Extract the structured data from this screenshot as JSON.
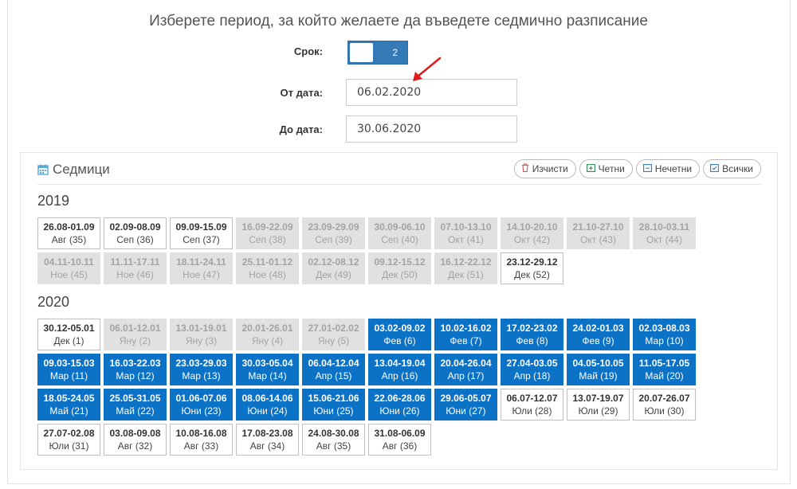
{
  "heading": "Изберете период, за който желаете да въведете седмично разписание",
  "term": {
    "label": "Срок:",
    "value": "2"
  },
  "from": {
    "label": "От дата:",
    "value": "06.02.2020"
  },
  "to": {
    "label": "До дата:",
    "value": "30.06.2020"
  },
  "colors": {
    "selected": "#0b72c6",
    "past": "#e1e1e1",
    "accent": "#337ab7",
    "arrow": "#e01b1b"
  },
  "panel": {
    "title": "Седмици",
    "buttons": {
      "clear": "Изчисти",
      "even": "Четни",
      "odd": "Нечетни",
      "all": "Всички"
    }
  },
  "years": [
    {
      "year": "2019",
      "weeks": [
        {
          "d": "26.08-01.09",
          "m": "Авг (35)",
          "s": "open"
        },
        {
          "d": "02.09-08.09",
          "m": "Сеп (36)",
          "s": "open"
        },
        {
          "d": "09.09-15.09",
          "m": "Сеп (37)",
          "s": "open"
        },
        {
          "d": "16.09-22.09",
          "m": "Сеп (38)",
          "s": "past"
        },
        {
          "d": "23.09-29.09",
          "m": "Сеп (39)",
          "s": "past"
        },
        {
          "d": "30.09-06.10",
          "m": "Сеп (40)",
          "s": "past"
        },
        {
          "d": "07.10-13.10",
          "m": "Окт (41)",
          "s": "past"
        },
        {
          "d": "14.10-20.10",
          "m": "Окт (42)",
          "s": "past"
        },
        {
          "d": "21.10-27.10",
          "m": "Окт (43)",
          "s": "past"
        },
        {
          "d": "28.10-03.11",
          "m": "Окт (44)",
          "s": "past"
        },
        {
          "d": "04.11-10.11",
          "m": "Ное (45)",
          "s": "past"
        },
        {
          "d": "11.11-17.11",
          "m": "Ное (46)",
          "s": "past"
        },
        {
          "d": "18.11-24.11",
          "m": "Ное (47)",
          "s": "past"
        },
        {
          "d": "25.11-01.12",
          "m": "Ное (48)",
          "s": "past"
        },
        {
          "d": "02.12-08.12",
          "m": "Дек (49)",
          "s": "past"
        },
        {
          "d": "09.12-15.12",
          "m": "Дек (50)",
          "s": "past"
        },
        {
          "d": "16.12-22.12",
          "m": "Дек (51)",
          "s": "past"
        },
        {
          "d": "23.12-29.12",
          "m": "Дек (52)",
          "s": "open"
        }
      ]
    },
    {
      "year": "2020",
      "weeks": [
        {
          "d": "30.12-05.01",
          "m": "Дек (1)",
          "s": "open"
        },
        {
          "d": "06.01-12.01",
          "m": "Яну (2)",
          "s": "past"
        },
        {
          "d": "13.01-19.01",
          "m": "Яну (3)",
          "s": "past"
        },
        {
          "d": "20.01-26.01",
          "m": "Яну (4)",
          "s": "past"
        },
        {
          "d": "27.01-02.02",
          "m": "Яну (5)",
          "s": "past"
        },
        {
          "d": "03.02-09.02",
          "m": "Фев (6)",
          "s": "sel"
        },
        {
          "d": "10.02-16.02",
          "m": "Фев (7)",
          "s": "sel"
        },
        {
          "d": "17.02-23.02",
          "m": "Фев (8)",
          "s": "sel"
        },
        {
          "d": "24.02-01.03",
          "m": "Фев (9)",
          "s": "sel"
        },
        {
          "d": "02.03-08.03",
          "m": "Мар (10)",
          "s": "sel"
        },
        {
          "d": "09.03-15.03",
          "m": "Мар (11)",
          "s": "sel"
        },
        {
          "d": "16.03-22.03",
          "m": "Мар (12)",
          "s": "sel"
        },
        {
          "d": "23.03-29.03",
          "m": "Мар (13)",
          "s": "sel"
        },
        {
          "d": "30.03-05.04",
          "m": "Мар (14)",
          "s": "sel"
        },
        {
          "d": "06.04-12.04",
          "m": "Апр (15)",
          "s": "sel"
        },
        {
          "d": "13.04-19.04",
          "m": "Апр (16)",
          "s": "sel"
        },
        {
          "d": "20.04-26.04",
          "m": "Апр (17)",
          "s": "sel"
        },
        {
          "d": "27.04-03.05",
          "m": "Апр (18)",
          "s": "sel"
        },
        {
          "d": "04.05-10.05",
          "m": "Май (19)",
          "s": "sel"
        },
        {
          "d": "11.05-17.05",
          "m": "Май (20)",
          "s": "sel"
        },
        {
          "d": "18.05-24.05",
          "m": "Май (21)",
          "s": "sel"
        },
        {
          "d": "25.05-31.05",
          "m": "Май (22)",
          "s": "sel"
        },
        {
          "d": "01.06-07.06",
          "m": "Юни (23)",
          "s": "sel"
        },
        {
          "d": "08.06-14.06",
          "m": "Юни (24)",
          "s": "sel"
        },
        {
          "d": "15.06-21.06",
          "m": "Юни (25)",
          "s": "sel"
        },
        {
          "d": "22.06-28.06",
          "m": "Юни (26)",
          "s": "sel"
        },
        {
          "d": "29.06-05.07",
          "m": "Юни (27)",
          "s": "sel"
        },
        {
          "d": "06.07-12.07",
          "m": "Юли (28)",
          "s": "open"
        },
        {
          "d": "13.07-19.07",
          "m": "Юли (29)",
          "s": "open"
        },
        {
          "d": "20.07-26.07",
          "m": "Юли (30)",
          "s": "open"
        },
        {
          "d": "27.07-02.08",
          "m": "Юли (31)",
          "s": "open"
        },
        {
          "d": "03.08-09.08",
          "m": "Авг (32)",
          "s": "open"
        },
        {
          "d": "10.08-16.08",
          "m": "Авг (33)",
          "s": "open"
        },
        {
          "d": "17.08-23.08",
          "m": "Авг (34)",
          "s": "open"
        },
        {
          "d": "24.08-30.08",
          "m": "Авг (35)",
          "s": "open"
        },
        {
          "d": "31.08-06.09",
          "m": "Авг (36)",
          "s": "open"
        }
      ]
    }
  ]
}
